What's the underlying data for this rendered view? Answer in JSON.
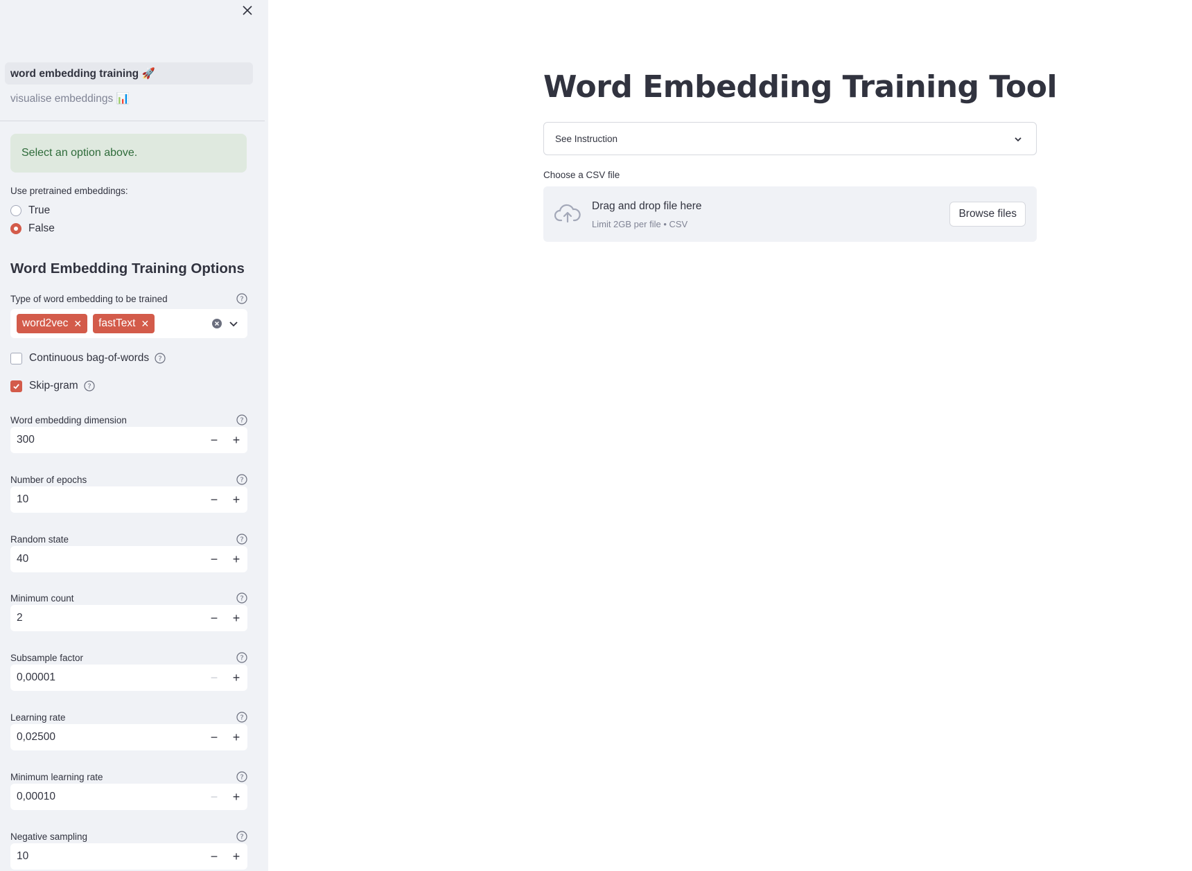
{
  "sidebar": {
    "nav": [
      {
        "label": "word embedding training 🚀",
        "active": true
      },
      {
        "label": "visualise embeddings 📊",
        "active": false
      }
    ],
    "alert": "Select an option above.",
    "pretrained": {
      "label": "Use pretrained embeddings:",
      "options": [
        "True",
        "False"
      ],
      "selected": "False"
    },
    "options_heading": "Word Embedding Training Options",
    "embedding_type": {
      "label": "Type of word embedding to be trained",
      "selected": [
        "word2vec",
        "fastText"
      ]
    },
    "cbow": {
      "label": "Continuous bag-of-words",
      "checked": false
    },
    "skipgram": {
      "label": "Skip-gram",
      "checked": true
    },
    "fields": [
      {
        "label": "Word embedding dimension",
        "value": "300",
        "minus_disabled": false
      },
      {
        "label": "Number of epochs",
        "value": "10",
        "minus_disabled": false
      },
      {
        "label": "Random state",
        "value": "40",
        "minus_disabled": false
      },
      {
        "label": "Minimum count",
        "value": "2",
        "minus_disabled": false
      },
      {
        "label": "Subsample factor",
        "value": "0,00001",
        "minus_disabled": true
      },
      {
        "label": "Learning rate",
        "value": "0,02500",
        "minus_disabled": false
      },
      {
        "label": "Minimum learning rate",
        "value": "0,00010",
        "minus_disabled": true
      },
      {
        "label": "Negative sampling",
        "value": "10",
        "minus_disabled": false
      }
    ]
  },
  "main": {
    "title": "Word Embedding Training Tool",
    "expander": "See Instruction",
    "uploader": {
      "label": "Choose a CSV file",
      "drop_text": "Drag and drop file here",
      "limit_text": "Limit 2GB per file • CSV",
      "browse_label": "Browse files"
    }
  },
  "colors": {
    "accent": "#d35b4a",
    "sidebar_bg": "#f0f2f6",
    "alert_bg": "#dfe9df",
    "alert_text": "#2e6b3a",
    "text": "#31333f"
  }
}
